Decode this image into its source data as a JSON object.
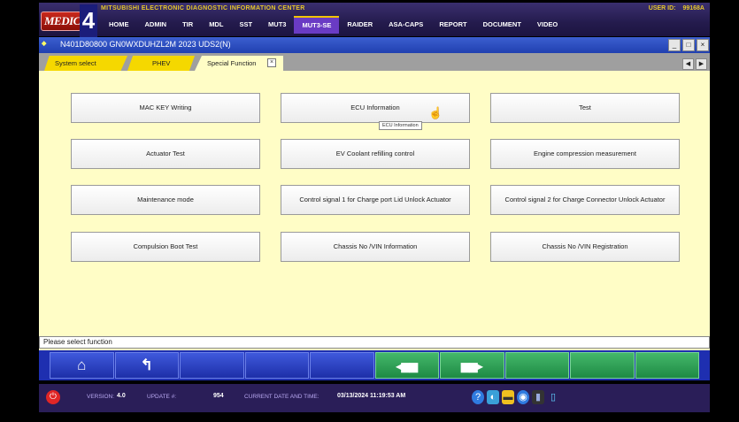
{
  "banner": {
    "logo_text": "MEDIC",
    "logo_num": "4",
    "app_name": "MITSUBISHI ELECTRONIC DIAGNOSTIC INFORMATION CENTER",
    "user_label": "USER ID:",
    "user_id": "99168A",
    "nav": [
      "HOME",
      "ADMIN",
      "TIR",
      "MDL",
      "SST",
      "MUT3",
      "MUT3-SE",
      "RAIDER",
      "ASA-CAPS",
      "REPORT",
      "DOCUMENT",
      "VIDEO"
    ],
    "active_nav": "MUT3-SE"
  },
  "window": {
    "title": "N401D80800  GN0WXDUHZL2M 2023   UDS2(N)",
    "controls": [
      "_",
      "□",
      "×"
    ]
  },
  "tabs": [
    {
      "label": "System select"
    },
    {
      "label": "PHEV"
    },
    {
      "label": "Special Function"
    }
  ],
  "tab_close": "×",
  "scroll": {
    "left": "◀",
    "right": "▶"
  },
  "functions": [
    "MAC KEY Writing",
    "ECU Information",
    "Test",
    "Actuator Test",
    "EV Coolant refilling control",
    "Engine compression measurement",
    "Maintenance mode",
    "Control signal 1 for Charge port Lid Unlock Actuator",
    "Control signal 2 for Charge Connector Unlock Actuator",
    "Compulsion Boot Test",
    "Chassis No /VIN Information",
    "Chassis No /VIN Registration"
  ],
  "tooltip": "ECU Information",
  "status_message": "Please select function",
  "footer": {
    "version_label": "VERSION:",
    "version": "4.0",
    "update_label": "UPDATE #:",
    "update": "954",
    "datetime_label": "CURRENT DATE AND TIME:",
    "datetime": "03/13/2024 11:19:53 AM"
  },
  "colors": {
    "banner": "#241b4d",
    "window_bg": "#fffdc6",
    "tab_yellow": "#f5d800",
    "titlebar": "#2b4ac0",
    "toolbar": "#1e2fb0"
  }
}
